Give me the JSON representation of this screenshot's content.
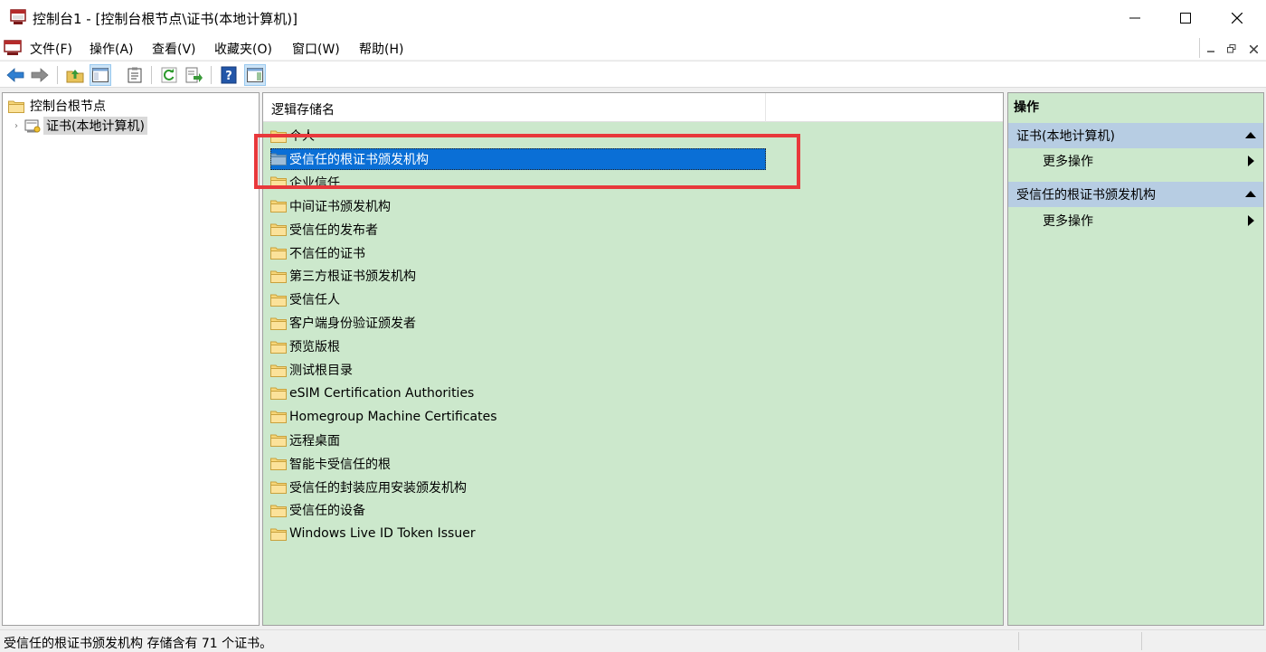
{
  "window": {
    "title": "控制台1 - [控制台根节点\\证书(本地计算机)]",
    "icon": "mmc-console-icon"
  },
  "menu": [
    "文件(F)",
    "操作(A)",
    "查看(V)",
    "收藏夹(O)",
    "窗口(W)",
    "帮助(H)"
  ],
  "toolbar": {
    "buttons": [
      "back-arrow-icon",
      "forward-arrow-icon",
      "up-folder-icon",
      "show-hide-tree-icon",
      "properties-icon",
      "refresh-icon",
      "export-list-icon",
      "help-icon",
      "show-hide-action-pane-icon"
    ]
  },
  "tree": {
    "root": "控制台根节点",
    "child": "证书(本地计算机)"
  },
  "list": {
    "column_header": "逻辑存储名",
    "items": [
      "个人",
      "受信任的根证书颁发机构",
      "企业信任",
      "中间证书颁发机构",
      "受信任的发布者",
      "不信任的证书",
      "第三方根证书颁发机构",
      "受信任人",
      "客户端身份验证颁发者",
      "预览版根",
      "测试根目录",
      "eSIM Certification Authorities",
      "Homegroup Machine Certificates",
      "远程桌面",
      "智能卡受信任的根",
      "受信任的封装应用安装颁发机构",
      "受信任的设备",
      "Windows Live ID Token Issuer"
    ],
    "selected": "受信任的根证书颁发机构"
  },
  "actions": {
    "title": "操作",
    "sections": [
      {
        "label": "证书(本地计算机)",
        "more": "更多操作"
      },
      {
        "label": "受信任的根证书颁发机构",
        "more": "更多操作"
      }
    ]
  },
  "status": "受信任的根证书颁发机构 存储含有 71 个证书。",
  "colors": {
    "pane_bg": "#cce8cc",
    "selection": "#0a6fd6",
    "highlight_box": "#e8383b",
    "section_header": "#b7cde3"
  }
}
